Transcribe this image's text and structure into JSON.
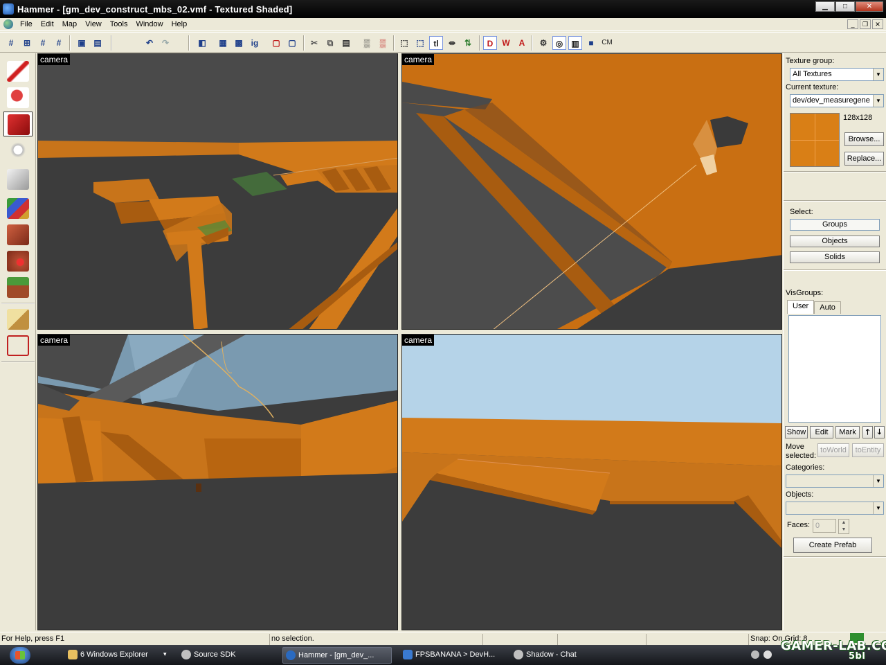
{
  "window": {
    "title": "Hammer - [gm_dev_construct_mbs_02.vmf - Textured Shaded]"
  },
  "window_controls": [
    "▁",
    "□",
    "✕"
  ],
  "menu": [
    "File",
    "Edit",
    "Map",
    "View",
    "Tools",
    "Window",
    "Help"
  ],
  "mdi_controls": [
    "_",
    "❐",
    "✕"
  ],
  "toolbar_labels": {
    "ig": "ig",
    "tl": "tl",
    "cm": "CM"
  },
  "palette_tools": [
    "selection-tool",
    "magnify-tool",
    "camera-tool",
    "entity-tool",
    "block-tool",
    "texture-application-tool",
    "apply-current-texture-tool",
    "decal-tool",
    "overlay-tool",
    "clipping-tool",
    "vertex-tool"
  ],
  "viewports": [
    {
      "label": "camera"
    },
    {
      "label": "camera"
    },
    {
      "label": "camera"
    },
    {
      "label": "camera"
    }
  ],
  "colors": {
    "brush_orange": "#d27a1a",
    "brush_orange_dark": "#a85c10",
    "floor_gray": "#3c3c3c",
    "sky_blue": "#b5d3e8"
  },
  "right_panel": {
    "texture_group_label": "Texture group:",
    "texture_group_value": "All Textures",
    "current_texture_label": "Current texture:",
    "current_texture_value": "dev/dev_measuregene",
    "texture_size": "128x128",
    "browse": "Browse...",
    "replace": "Replace...",
    "select_label": "Select:",
    "select_buttons": [
      "Groups",
      "Objects",
      "Solids"
    ],
    "visgroups_label": "VisGroups:",
    "vis_tabs": [
      "User",
      "Auto"
    ],
    "vis_buttons": [
      "Show",
      "Edit",
      "Mark"
    ],
    "move_selected_line1": "Move",
    "move_selected_line2": "selected:",
    "to_world": "toWorld",
    "to_entity": "toEntity",
    "categories_label": "Categories:",
    "objects_label": "Objects:",
    "faces_label": "Faces:",
    "faces_value": "0",
    "create_prefab": "Create Prefab"
  },
  "status": {
    "help": "For Help, press F1",
    "selection": "no selection.",
    "snap": "Snap: On Grid: 8"
  },
  "taskbar": {
    "tasks": [
      {
        "label": "6 Windows Explorer",
        "active": false
      },
      {
        "label": "Source SDK",
        "active": false
      },
      {
        "label": "Hammer - [gm_dev_...",
        "active": true
      },
      {
        "label": "FPSBANANA > DevH...",
        "active": false
      },
      {
        "label": "Shadow - Chat",
        "active": false
      }
    ],
    "dropdown_arrow": "▾"
  },
  "watermark": {
    "line1": "GAMER-LAB.COM",
    "line2": "5bl"
  }
}
